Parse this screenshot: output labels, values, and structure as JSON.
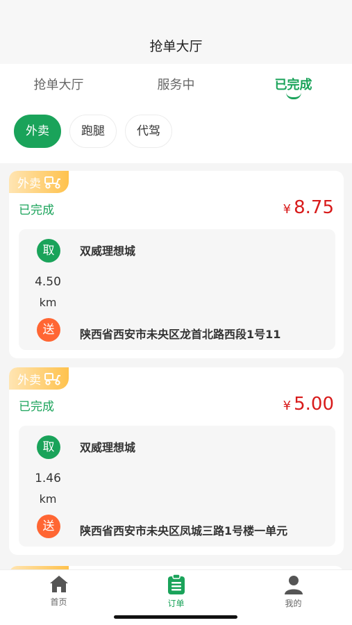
{
  "header": {
    "title": "抢单大厅"
  },
  "tabs": [
    {
      "label": "抢单大厅",
      "active": false
    },
    {
      "label": "服务中",
      "active": false
    },
    {
      "label": "已完成",
      "active": true
    }
  ],
  "chips": [
    {
      "label": "外卖",
      "active": true
    },
    {
      "label": "跑腿",
      "active": false
    },
    {
      "label": "代驾",
      "active": false
    }
  ],
  "orders": [
    {
      "tag": "外卖",
      "status": "已完成",
      "currency": "¥",
      "price": "8.75",
      "pickup_badge": "取",
      "pickup_name": "双威理想城",
      "distance": "4.50",
      "distance_unit": "km",
      "dropoff_badge": "送",
      "dropoff_address": "陕西省西安市未央区龙首北路西段1号11"
    },
    {
      "tag": "外卖",
      "status": "已完成",
      "currency": "¥",
      "price": "5.00",
      "pickup_badge": "取",
      "pickup_name": "双威理想城",
      "distance": "1.46",
      "distance_unit": "km",
      "dropoff_badge": "送",
      "dropoff_address": "陕西省西安市未央区凤城三路1号楼一单元"
    }
  ],
  "tabbar": [
    {
      "label": "首页",
      "icon": "home-icon"
    },
    {
      "label": "订单",
      "icon": "order-clipboard-icon",
      "active": true
    },
    {
      "label": "我的",
      "icon": "user-icon"
    }
  ],
  "colors": {
    "accent": "#1aa35a",
    "price": "#d81b1b",
    "drop": "#ff6633",
    "tag": "#ffc24d"
  }
}
